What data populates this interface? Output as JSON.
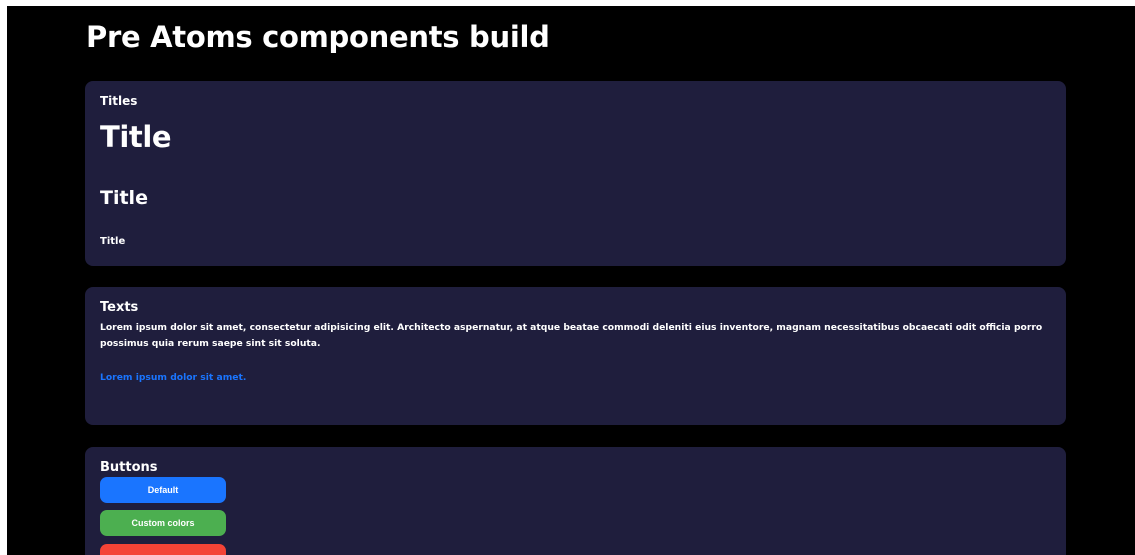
{
  "page": {
    "title": "Pre Atoms components build"
  },
  "titles_card": {
    "label": "Titles",
    "title_large": "Title",
    "title_medium": "Title",
    "title_small": "Title"
  },
  "texts_card": {
    "label": "Texts",
    "paragraph": "Lorem ipsum dolor sit amet, consectetur adipisicing elit. Architecto aspernatur, at atque beatae commodi deleniti eius inventore, magnam necessitatibus obcaecati odit officia porro possimus quia rerum saepe sint sit soluta.",
    "link": "Lorem ipsum dolor sit amet."
  },
  "buttons_card": {
    "label": "Buttons",
    "buttons": [
      {
        "label": "Default",
        "color": "#1a75ff"
      },
      {
        "label": "Custom colors",
        "color": "#4caf50"
      },
      {
        "label": "",
        "color": "#f44336"
      }
    ]
  },
  "colors": {
    "background": "#000000",
    "card": "#1f1e3d",
    "text": "#ffffff",
    "link": "#1a75ff"
  }
}
